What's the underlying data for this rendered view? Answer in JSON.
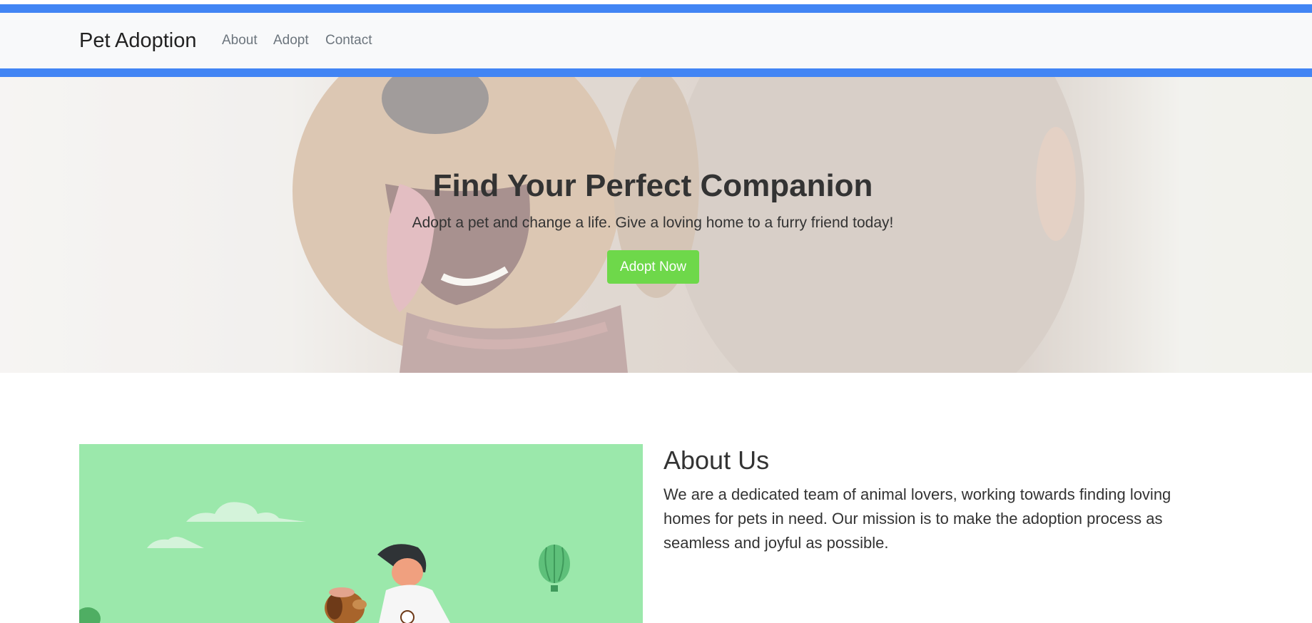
{
  "navbar": {
    "brand": "Pet Adoption",
    "links": [
      "About",
      "Adopt",
      "Contact"
    ]
  },
  "hero": {
    "title": "Find Your Perfect Companion",
    "subtitle": "Adopt a pet and change a life. Give a loving home to a furry friend today!",
    "button_label": "Adopt Now",
    "background_image": "dog-and-person-photo"
  },
  "about": {
    "title": "About Us",
    "text": "We are a dedicated team of animal lovers, working towards finding loving homes for pets in need. Our mission is to make the adoption process as seamless and joyful as possible.",
    "illustration": "boy-with-dog-illustration"
  },
  "colors": {
    "navbar_border": "#4285f4",
    "navbar_bg": "#f8f9fa",
    "button": "#6ed84a",
    "illustration_bg": "#9be8ab"
  }
}
